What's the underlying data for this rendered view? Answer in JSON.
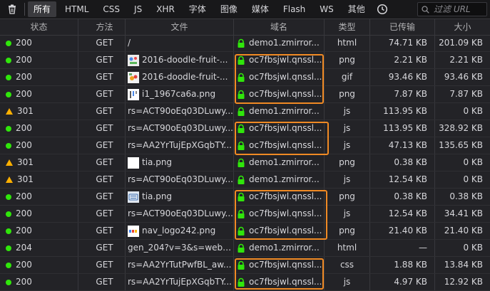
{
  "toolbar": {
    "filters": [
      {
        "label": "所有",
        "active": true
      },
      {
        "label": "HTML"
      },
      {
        "label": "CSS"
      },
      {
        "label": "JS"
      },
      {
        "label": "XHR"
      },
      {
        "label": "字体"
      },
      {
        "label": "图像"
      },
      {
        "label": "媒体"
      },
      {
        "label": "Flash"
      },
      {
        "label": "WS"
      },
      {
        "label": "其他"
      }
    ],
    "search_placeholder": "过滤 URL"
  },
  "columns": {
    "status": "状态",
    "method": "方法",
    "file": "文件",
    "domain": "域名",
    "type": "类型",
    "transferred": "已传输",
    "size": "大小"
  },
  "colors": {
    "ok": "#30e60b",
    "redirect": "#ffb000",
    "highlight": "#f08a24",
    "secure": "#30e60b"
  },
  "rows": [
    {
      "status": "200",
      "status_icon": "green-dot-icon",
      "method": "GET",
      "file": "/",
      "thumb": "",
      "domain": "demo1.zmirror...",
      "type": "html",
      "transferred": "74.71 KB",
      "size": "201.09 KB"
    },
    {
      "status": "200",
      "status_icon": "green-dot-icon",
      "method": "GET",
      "file": "2016-doodle-fruit-...",
      "thumb": "doodle-image-icon",
      "domain": "oc7fbsjwl.qnssl...",
      "type": "png",
      "transferred": "2.21 KB",
      "size": "2.21 KB"
    },
    {
      "status": "200",
      "status_icon": "green-dot-icon",
      "method": "GET",
      "file": "2016-doodle-fruit-...",
      "thumb": "fruit-image-icon",
      "domain": "oc7fbsjwl.qnssl...",
      "type": "gif",
      "transferred": "93.46 KB",
      "size": "93.46 KB"
    },
    {
      "status": "200",
      "status_icon": "green-dot-icon",
      "method": "GET",
      "file": "i1_1967ca6a.png",
      "thumb": "sprite-image-icon",
      "domain": "oc7fbsjwl.qnssl...",
      "type": "png",
      "transferred": "7.87 KB",
      "size": "7.87 KB"
    },
    {
      "status": "301",
      "status_icon": "warning-triangle-icon",
      "method": "GET",
      "file": "rs=ACT90oEq03DLuwy...",
      "thumb": "",
      "domain": "demo1.zmirror...",
      "type": "js",
      "transferred": "113.95 KB",
      "size": "0 KB"
    },
    {
      "status": "200",
      "status_icon": "green-dot-icon",
      "method": "GET",
      "file": "rs=ACT90oEq03DLuwy...",
      "thumb": "",
      "domain": "oc7fbsjwl.qnssl...",
      "type": "js",
      "transferred": "113.95 KB",
      "size": "328.92 KB"
    },
    {
      "status": "200",
      "status_icon": "green-dot-icon",
      "method": "GET",
      "file": "rs=AA2YrTujEpXGqbTY...",
      "thumb": "",
      "domain": "oc7fbsjwl.qnssl...",
      "type": "js",
      "transferred": "47.13 KB",
      "size": "135.65 KB"
    },
    {
      "status": "301",
      "status_icon": "warning-triangle-icon",
      "method": "GET",
      "file": "tia.png",
      "thumb": "blank-image-icon",
      "domain": "demo1.zmirror...",
      "type": "png",
      "transferred": "0.38 KB",
      "size": "0 KB"
    },
    {
      "status": "301",
      "status_icon": "warning-triangle-icon",
      "method": "GET",
      "file": "rs=ACT90oEq03DLuwy...",
      "thumb": "",
      "domain": "demo1.zmirror...",
      "type": "js",
      "transferred": "12.54 KB",
      "size": "0 KB"
    },
    {
      "status": "200",
      "status_icon": "green-dot-icon",
      "method": "GET",
      "file": "tia.png",
      "thumb": "keyboard-image-icon",
      "domain": "oc7fbsjwl.qnssl...",
      "type": "png",
      "transferred": "0.38 KB",
      "size": "0.38 KB"
    },
    {
      "status": "200",
      "status_icon": "green-dot-icon",
      "method": "GET",
      "file": "rs=ACT90oEq03DLuwy...",
      "thumb": "",
      "domain": "oc7fbsjwl.qnssl...",
      "type": "js",
      "transferred": "12.54 KB",
      "size": "34.41 KB"
    },
    {
      "status": "200",
      "status_icon": "green-dot-icon",
      "method": "GET",
      "file": "nav_logo242.png",
      "thumb": "logo-image-icon",
      "domain": "oc7fbsjwl.qnssl...",
      "type": "png",
      "transferred": "21.40 KB",
      "size": "21.40 KB"
    },
    {
      "status": "204",
      "status_icon": "green-dot-icon",
      "method": "GET",
      "file": "gen_204?v=3&s=webh...",
      "thumb": "",
      "domain": "demo1.zmirror...",
      "type": "html",
      "transferred": "—",
      "size": "0 KB"
    },
    {
      "status": "200",
      "status_icon": "green-dot-icon",
      "method": "GET",
      "file": "rs=AA2YrTutPwfBL_aw...",
      "thumb": "",
      "domain": "oc7fbsjwl.qnssl...",
      "type": "css",
      "transferred": "1.88 KB",
      "size": "13.84 KB"
    },
    {
      "status": "200",
      "status_icon": "green-dot-icon",
      "method": "GET",
      "file": "rs=AA2YrTujEpXGqbTY...",
      "thumb": "",
      "domain": "oc7fbsjwl.qnssl...",
      "type": "js",
      "transferred": "4.97 KB",
      "size": "12.92 KB"
    }
  ]
}
